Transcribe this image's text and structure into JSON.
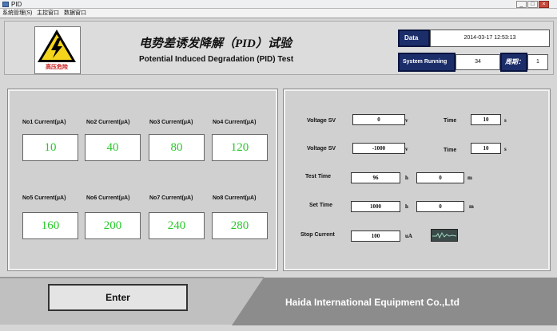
{
  "window": {
    "title": "PID",
    "minimize": "_",
    "maximize": "□",
    "close": "×"
  },
  "menu": [
    "系统管理(S)",
    "主控窗口",
    "数据窗口"
  ],
  "header": {
    "logo_text": "高压危险",
    "title_zh": "电势差诱发降解（PID）试验",
    "title_en": "Potential Induced Degradation (PID) Test",
    "date_label": "Data",
    "date_value": "2014-03-17 12:53:13",
    "status_label": "System Running",
    "status_value": "34",
    "cycle_label": "周期：",
    "cycle_value": "1"
  },
  "currents": [
    {
      "label": "No1 Current(μA)",
      "value": "10"
    },
    {
      "label": "No2 Current(μA)",
      "value": "40"
    },
    {
      "label": "No3 Current(μA)",
      "value": "80"
    },
    {
      "label": "No4 Current(μA)",
      "value": "120"
    },
    {
      "label": "No5 Current(μA)",
      "value": "160"
    },
    {
      "label": "No6 Current(μA)",
      "value": "200"
    },
    {
      "label": "No7 Current(μA)",
      "value": "240"
    },
    {
      "label": "No8 Current(μA)",
      "value": "280"
    }
  ],
  "settings": {
    "voltage_sv_1": {
      "label": "Voltage SV",
      "value": "0",
      "unit": "v"
    },
    "time_1": {
      "label": "Time",
      "value": "10",
      "unit": "s"
    },
    "voltage_sv_2": {
      "label": "Voltage SV",
      "value": "-1000",
      "unit": "v"
    },
    "time_2": {
      "label": "Time",
      "value": "10",
      "unit": "s"
    },
    "test_time": {
      "label": "Test Time",
      "hours": "96",
      "h_unit": "h",
      "minutes": "0",
      "m_unit": "m"
    },
    "set_time": {
      "label": "Set Time",
      "hours": "1000",
      "h_unit": "h",
      "minutes": "0",
      "m_unit": "m"
    },
    "stop_current": {
      "label": "Stop Current",
      "value": "100",
      "unit": "uA"
    }
  },
  "footer": {
    "enter_label": "Enter",
    "company": "Haida International Equipment Co.,Ltd"
  },
  "colors": {
    "current_value": "#28c82a",
    "status_bg": "#1c2e6a",
    "close_btn": "#c94a3c"
  }
}
